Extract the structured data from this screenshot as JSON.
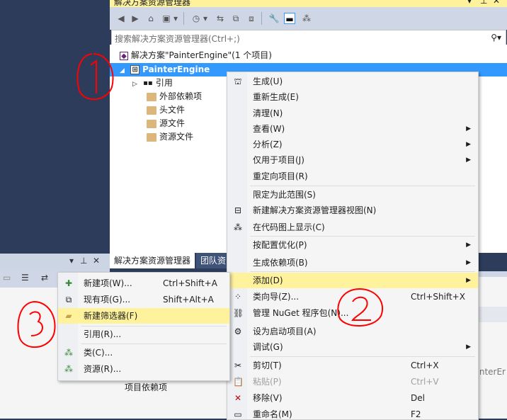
{
  "solution_explorer": {
    "title": "解决方案资源管理器",
    "pin_icon": "pin-icon",
    "close_label": "✕",
    "search_placeholder": "搜索解决方案资源管理器(Ctrl+;)",
    "tree": {
      "solution": "解决方案\"PainterEngine\"(1 个项目)",
      "project": "PainterEngine",
      "items": [
        "引用",
        "外部依赖项",
        "头文件",
        "源文件",
        "资源文件"
      ]
    },
    "tabs": [
      "解决方案资源管理器",
      "团队资"
    ]
  },
  "context_menu": {
    "items": [
      {
        "label": "生成(U)",
        "icon": "build-icon"
      },
      {
        "label": "重新生成(E)"
      },
      {
        "label": "清理(N)"
      },
      {
        "label": "查看(W)",
        "submenu": true
      },
      {
        "label": "分析(Z)",
        "submenu": true
      },
      {
        "label": "仅用于项目(J)",
        "submenu": true
      },
      {
        "label": "重定向项目(R)"
      },
      {
        "label": "限定为此范围(S)"
      },
      {
        "label": "新建解决方案资源管理器视图(N)",
        "icon": "new-view-icon"
      },
      {
        "label": "在代码图上显示(C)",
        "icon": "code-map-icon"
      },
      {
        "label": "按配置优化(P)",
        "submenu": true
      },
      {
        "label": "生成依赖项(B)",
        "submenu": true
      },
      {
        "label": "添加(D)",
        "submenu": true,
        "highlighted": true
      },
      {
        "label": "类向导(Z)...",
        "shortcut": "Ctrl+Shift+X",
        "icon": "class-wizard-icon"
      },
      {
        "label": "管理 NuGet 程序包(N)...",
        "icon": "nuget-icon"
      },
      {
        "label": "设为启动项目(A)",
        "icon": "gear-icon"
      },
      {
        "label": "调试(G)",
        "submenu": true
      },
      {
        "label": "剪切(T)",
        "shortcut": "Ctrl+X",
        "icon": "cut-icon"
      },
      {
        "label": "粘贴(P)",
        "shortcut": "Ctrl+V",
        "icon": "paste-icon",
        "disabled": true
      },
      {
        "label": "移除(V)",
        "shortcut": "Del",
        "icon": "remove-icon"
      },
      {
        "label": "重命名(M)",
        "shortcut": "F2",
        "icon": "rename-icon"
      }
    ]
  },
  "add_submenu": {
    "items": [
      {
        "label": "新建项(W)...",
        "shortcut": "Ctrl+Shift+A",
        "icon": "new-item-icon"
      },
      {
        "label": "现有项(G)...",
        "shortcut": "Shift+Alt+A",
        "icon": "existing-item-icon"
      },
      {
        "label": "新建筛选器(F)",
        "icon": "new-filter-icon",
        "highlighted": true
      },
      {
        "label": "引用(R)..."
      },
      {
        "label": "类(C)...",
        "icon": "class-icon"
      },
      {
        "label": "资源(R)...",
        "icon": "resource-icon"
      }
    ]
  },
  "bottom_panel": {
    "text": "项目依赖项"
  },
  "right_panel": {
    "partial_text": "interEr"
  },
  "annotations": [
    "①",
    "②",
    "③"
  ],
  "colors": {
    "accent": "#3399ff",
    "highlight": "#fff29d",
    "background": "#2d3c5a",
    "annotation": "#ff0000"
  }
}
